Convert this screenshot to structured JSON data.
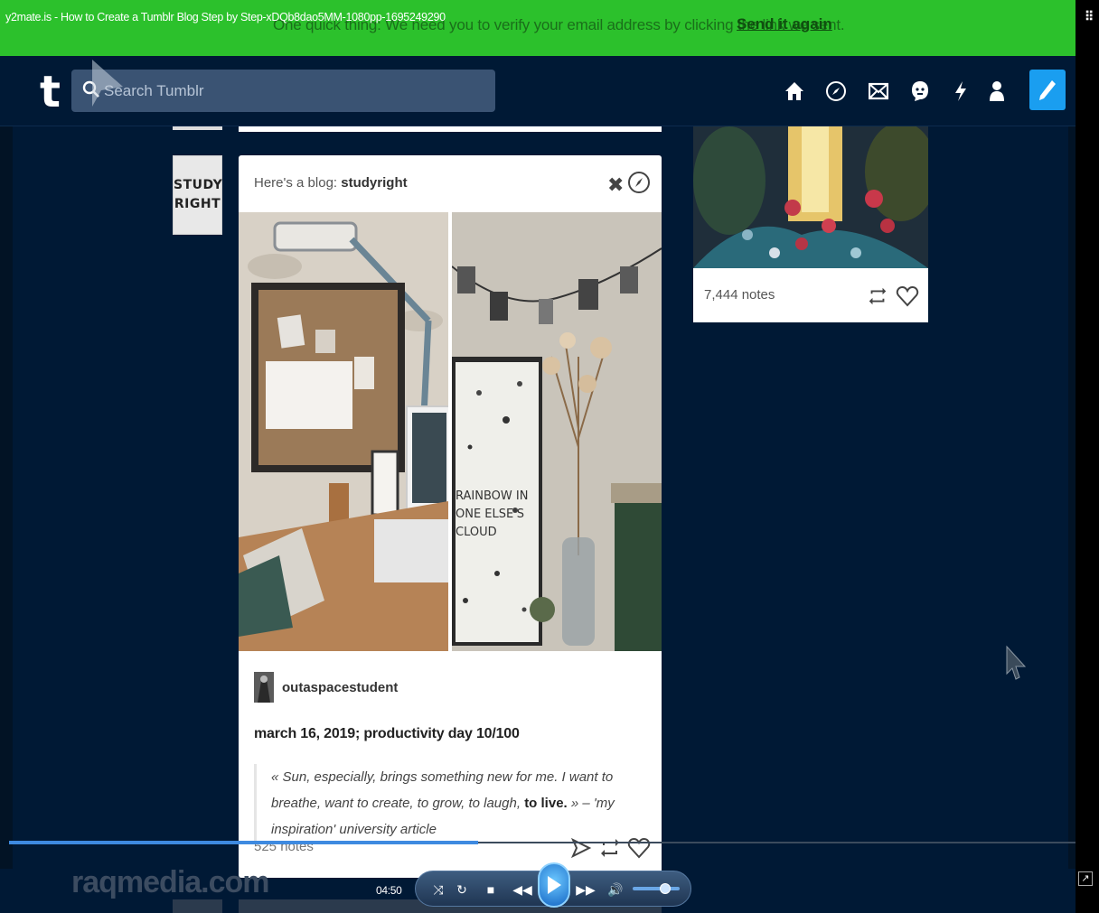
{
  "video_title": "y2mate.is - How to Create a Tumblr Blog Step by Step-xDQb8dao5MM-1080pp-1695249290",
  "verify_bar": {
    "message": "One quick thing:  We need you to verify your email address by clicking the link we sent.",
    "link": "Send it again"
  },
  "header": {
    "logo": "t",
    "search_placeholder": "Search Tumblr",
    "nav_icons": [
      "home-icon",
      "explore-icon",
      "inbox-icon",
      "messaging-icon",
      "activity-icon",
      "account-icon",
      "compose-icon"
    ]
  },
  "left_avatar": {
    "line1": "STUDY",
    "line2": "RIGHT"
  },
  "blog_card": {
    "heading_prefix": "Here's a blog:",
    "blog_name": "studyright",
    "author": "outaspacestudent",
    "title": "march 16, 2019;  productivity day 10/100",
    "quote_part1": "« Sun, especially, brings something new for me. I want to breathe, want to create, to grow, to laugh,",
    "quote_bold": "to live.",
    "quote_part2": "» – 'my inspiration' university article",
    "notes": "525 notes",
    "poster_text": "RAINBOW IN\nONE ELSE'S\nCLOUD"
  },
  "right_card": {
    "notes": "7,444 notes"
  },
  "player": {
    "time": "04:50",
    "progress": 0.44,
    "volume": 0.7,
    "watermark": "raqmedia.com"
  },
  "colors": {
    "tumblr_navy": "#001935",
    "verify_green": "#2cc12c",
    "compose_blue": "#1a9ef0"
  }
}
